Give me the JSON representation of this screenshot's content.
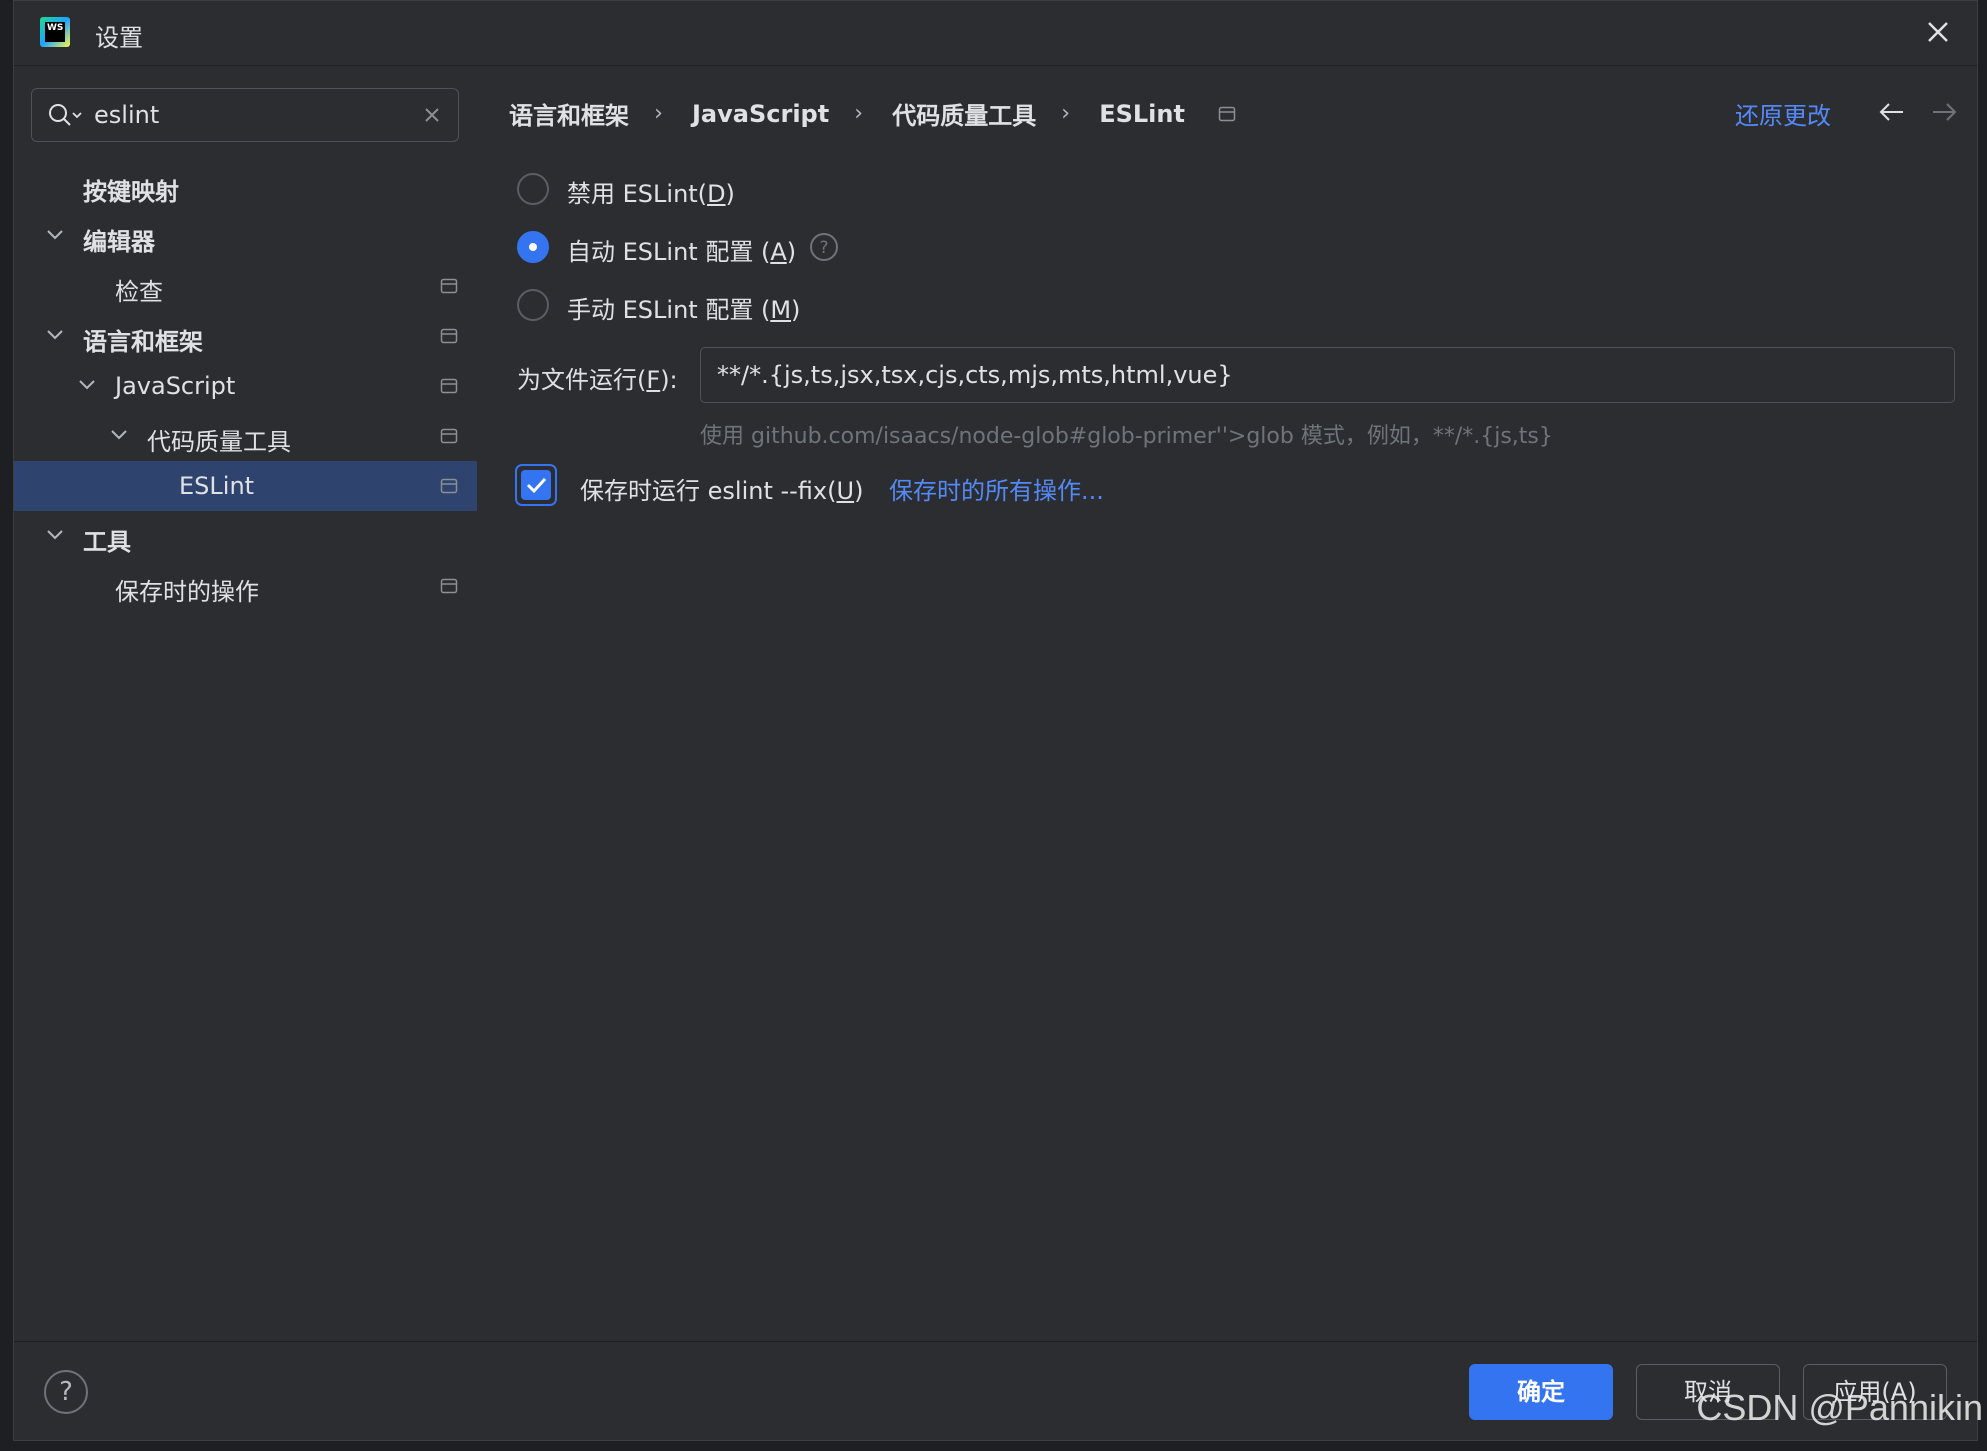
{
  "window": {
    "title": "设置"
  },
  "search": {
    "value": "eslint"
  },
  "tree": [
    {
      "label": "按键映射"
    },
    {
      "label": "编辑器"
    },
    {
      "label": "检查"
    },
    {
      "label": "语言和框架"
    },
    {
      "label": "JavaScript"
    },
    {
      "label": "代码质量工具"
    },
    {
      "label": "ESLint",
      "selected": true
    },
    {
      "label": "工具"
    },
    {
      "label": "保存时的操作"
    }
  ],
  "breadcrumb": [
    "语言和框架",
    "JavaScript",
    "代码质量工具",
    "ESLint"
  ],
  "header": {
    "revert_label": "还原更改"
  },
  "options": {
    "disable_label": "禁用 ESLint(",
    "disable_mnemonic": "D",
    "auto_label": "自动 ESLint 配置 (",
    "auto_mnemonic": "A",
    "manual_label": "手动 ESLint 配置 (",
    "manual_mnemonic": "M",
    "selected": "auto"
  },
  "run_for_files": {
    "label": "为文件运行(",
    "mnemonic": "F",
    "value": "**/*.{js,ts,jsx,tsx,cjs,cts,mjs,mts,html,vue}",
    "hint": "使用 github.com/isaacs/node-glob#glob-primer''>glob 模式，例如，**/*.{js,ts}"
  },
  "fix_on_save": {
    "label": "保存时运行 eslint --fix(",
    "mnemonic": "U",
    "checked": true,
    "link": "保存时的所有操作..."
  },
  "footer": {
    "help": "?",
    "ok": "确定",
    "cancel": "取消",
    "apply": "应用(A)"
  },
  "watermark": "CSDN @Pannikin",
  "colors": {
    "accent": "#3574f0",
    "link": "#548af7",
    "selected_row": "#2e436e",
    "background": "#2b2d30"
  }
}
